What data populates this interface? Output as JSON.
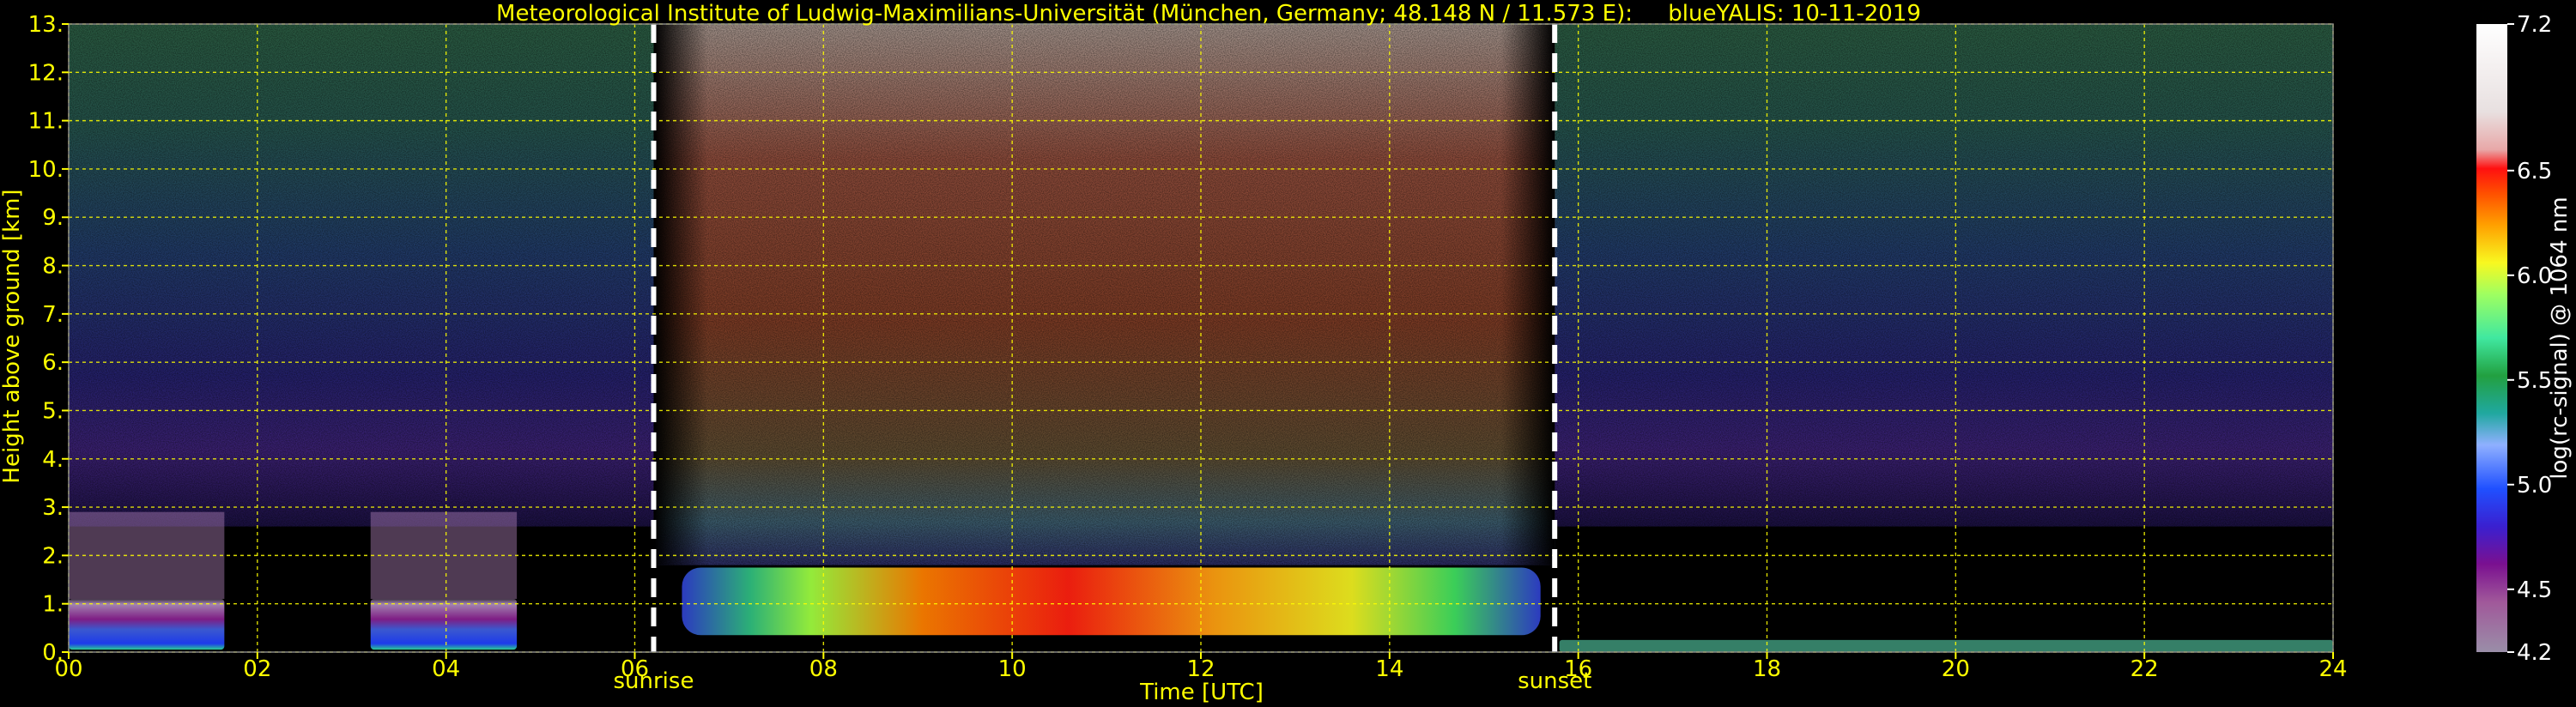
{
  "chart_data": {
    "type": "heatmap",
    "title": "Meteorological Institute of Ludwig-Maximilians-Universität (München, Germany; 48.148 N / 11.573 E):     blueYALIS: 10-11-2019",
    "xlabel": "Time [UTC]",
    "ylabel": "Height above ground [km]",
    "xlim": [
      0,
      24
    ],
    "ylim": [
      0,
      13
    ],
    "x_ticks": [
      "00",
      "02",
      "04",
      "06",
      "08",
      "10",
      "12",
      "14",
      "16",
      "18",
      "20",
      "22",
      "24"
    ],
    "y_ticks": [
      "0.",
      "1.",
      "2.",
      "3.",
      "4.",
      "5.",
      "6.",
      "7.",
      "8.",
      "9.",
      "10.",
      "11.",
      "12.",
      "13."
    ],
    "grid": true,
    "events": [
      {
        "label": "sunrise",
        "x": 6.2
      },
      {
        "label": "sunset",
        "x": 15.75
      }
    ],
    "colorbar": {
      "label": "log(rc-signal) @ 1064 nm",
      "range": [
        4.2,
        7.2
      ],
      "ticks": [
        "4.2",
        "4.5",
        "5.0",
        "5.5",
        "6.0",
        "6.5",
        "7.2"
      ]
    },
    "features": [
      {
        "name": "nocturnal aerosol layer",
        "x": [
          0,
          1.65
        ],
        "y": [
          0.05,
          1.1
        ],
        "level": 5.0
      },
      {
        "name": "nocturnal aerosol layer",
        "x": [
          3.2,
          4.75
        ],
        "y": [
          0.05,
          1.1
        ],
        "level": 4.9
      },
      {
        "name": "boundary layer",
        "x": [
          6.5,
          15.6
        ],
        "y": [
          0.35,
          1.75
        ],
        "level": 6.3
      },
      {
        "name": "daylight background",
        "x": [
          6.2,
          15.75
        ],
        "y": [
          2,
          13
        ],
        "level": 6.6
      },
      {
        "name": "near-ground layer",
        "x": [
          15.8,
          24
        ],
        "y": [
          0,
          0.25
        ],
        "level": 5.6
      }
    ]
  },
  "colors": {
    "text": "#ffff00",
    "grid": "#ffff00",
    "background": "#000000",
    "markers": "#ffffff"
  }
}
